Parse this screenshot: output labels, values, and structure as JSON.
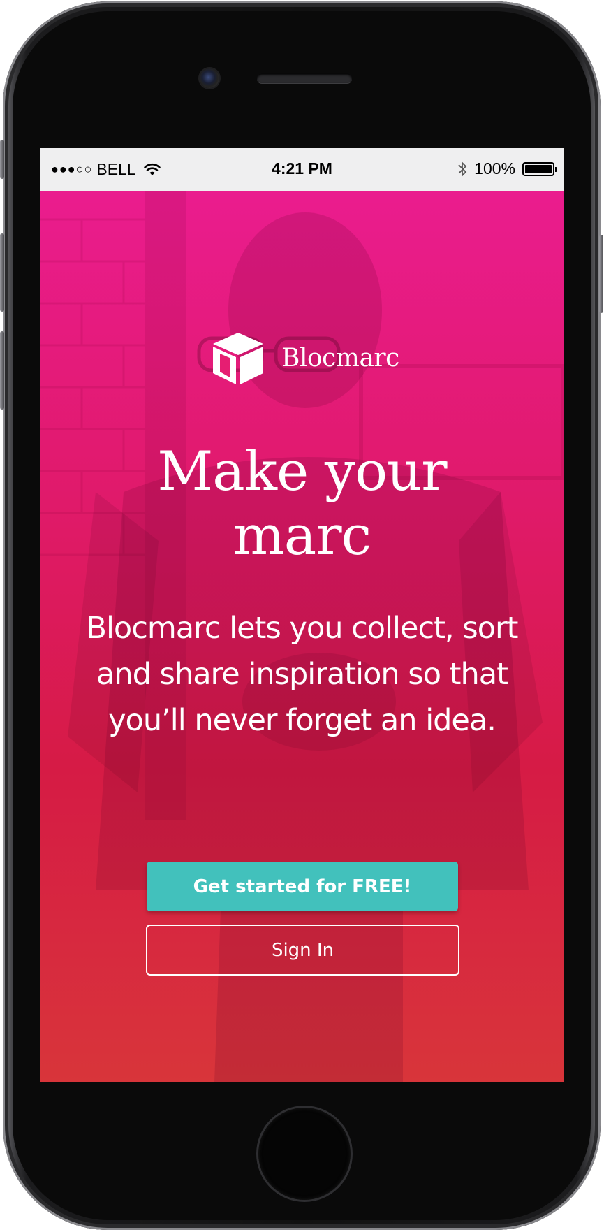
{
  "status_bar": {
    "signal": "●●●○○",
    "carrier": "BELL",
    "time": "4:21 PM",
    "battery": "100%",
    "battery_level_percent": 100,
    "icons": [
      "wifi-icon",
      "bluetooth-icon",
      "battery-icon"
    ]
  },
  "app": {
    "logo_text": "Blocmarc",
    "logo_icon": "cube-icon",
    "headline": "Make your marc",
    "description": "Blocmarc lets you collect, sort and share inspiration so that you’ll never forget an idea.",
    "primary_button": "Get started for FREE!",
    "secondary_button": "Sign In"
  },
  "colors": {
    "gradient_top": "#ea1c8e",
    "gradient_bottom": "#d8353a",
    "primary_button": "#42c1bc",
    "status_bar_bg": "#efeff0",
    "text": "#ffffff"
  }
}
